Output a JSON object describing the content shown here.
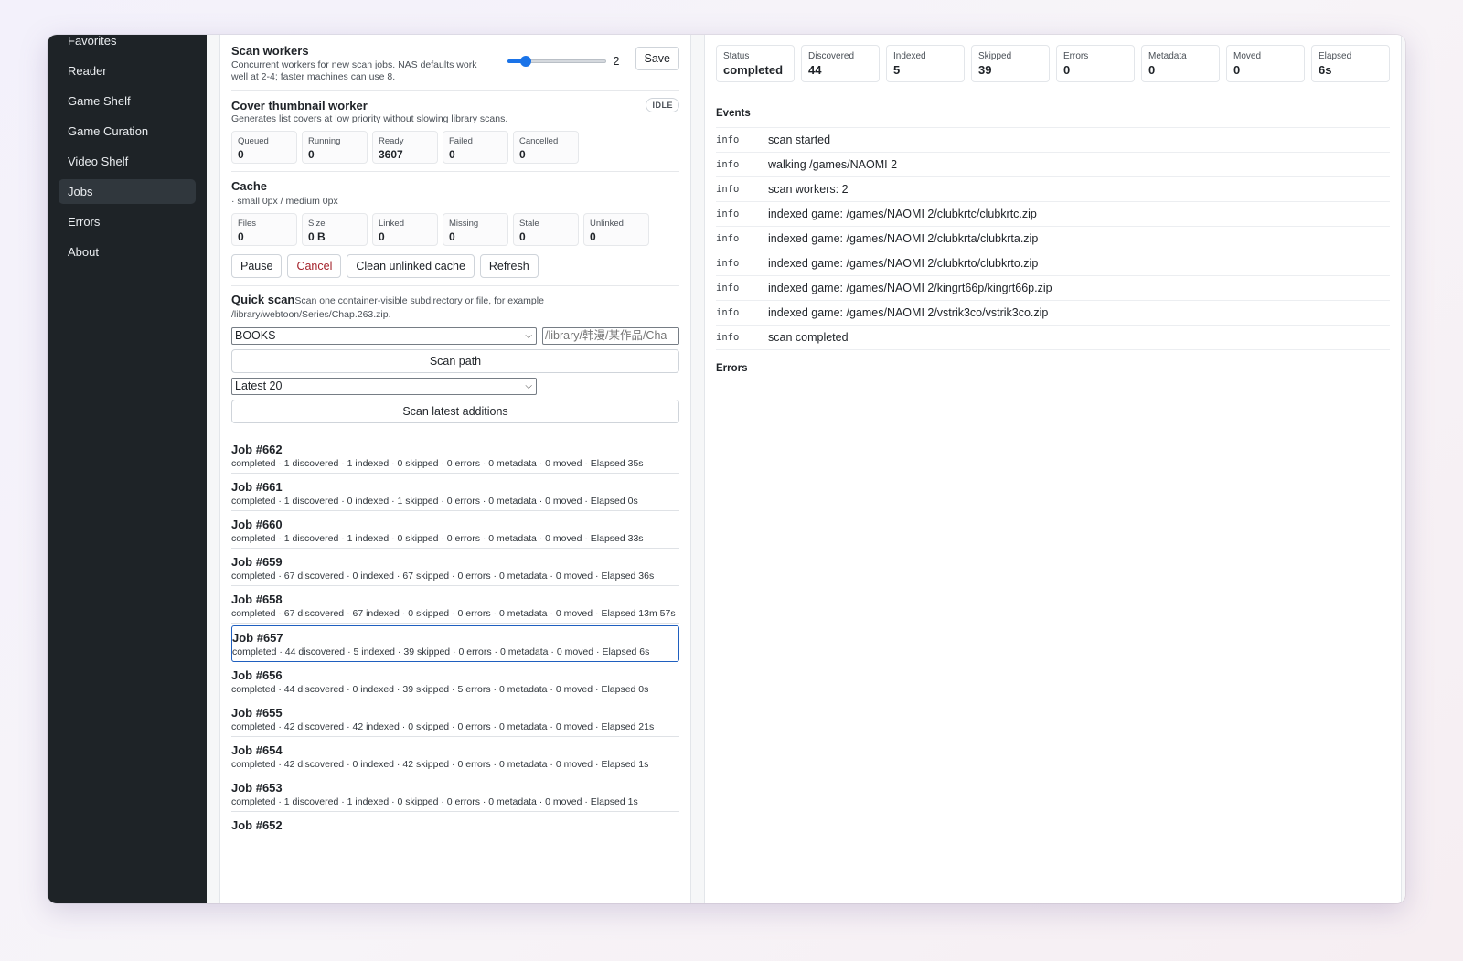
{
  "sidebar": {
    "items": [
      {
        "label": "Favorites",
        "active": false
      },
      {
        "label": "Reader",
        "active": false
      },
      {
        "label": "Game Shelf",
        "active": false
      },
      {
        "label": "Game Curation",
        "active": false
      },
      {
        "label": "Video Shelf",
        "active": false
      },
      {
        "label": "Jobs",
        "active": true
      },
      {
        "label": "Errors",
        "active": false
      },
      {
        "label": "About",
        "active": false
      }
    ]
  },
  "scan_workers": {
    "title": "Scan workers",
    "hint": "Concurrent workers for new scan jobs. NAS defaults work well at 2-4; faster machines can use 8.",
    "value": "2",
    "slider_fraction": 0.125,
    "save_label": "Save"
  },
  "thumb_worker": {
    "title": "Cover thumbnail worker",
    "hint": "Generates list covers at low priority without slowing library scans.",
    "badge": "IDLE",
    "stats": [
      {
        "label": "Queued",
        "value": "0"
      },
      {
        "label": "Running",
        "value": "0"
      },
      {
        "label": "Ready",
        "value": "3607"
      },
      {
        "label": "Failed",
        "value": "0"
      },
      {
        "label": "Cancelled",
        "value": "0"
      }
    ]
  },
  "cache": {
    "title": "Cache",
    "hint": "· small 0px / medium 0px",
    "stats": [
      {
        "label": "Files",
        "value": "0"
      },
      {
        "label": "Size",
        "value": "0 B"
      },
      {
        "label": "Linked",
        "value": "0"
      },
      {
        "label": "Missing",
        "value": "0"
      },
      {
        "label": "Stale",
        "value": "0"
      },
      {
        "label": "Unlinked",
        "value": "0"
      }
    ],
    "buttons": {
      "pause": "Pause",
      "cancel": "Cancel",
      "clean": "Clean unlinked cache",
      "refresh": "Refresh"
    }
  },
  "quick_scan": {
    "title": "Quick scan",
    "hint": "Scan one container-visible subdirectory or file, for example /library/webtoon/Series/Chap.263.zip.",
    "library_select": "BOOKS",
    "path_placeholder": "/library/韩漫/某作品/Cha",
    "scan_path_label": "Scan path",
    "latest_select": "Latest 20",
    "scan_latest_label": "Scan latest additions"
  },
  "jobs": [
    {
      "title": "Job #662",
      "summary": "completed · 1 discovered · 1 indexed · 0 skipped · 0 errors · 0 metadata · 0 moved · Elapsed 35s",
      "selected": false
    },
    {
      "title": "Job #661",
      "summary": "completed · 1 discovered · 0 indexed · 1 skipped · 0 errors · 0 metadata · 0 moved · Elapsed 0s",
      "selected": false
    },
    {
      "title": "Job #660",
      "summary": "completed · 1 discovered · 1 indexed · 0 skipped · 0 errors · 0 metadata · 0 moved · Elapsed 33s",
      "selected": false
    },
    {
      "title": "Job #659",
      "summary": "completed · 67 discovered · 0 indexed · 67 skipped · 0 errors · 0 metadata · 0 moved · Elapsed 36s",
      "selected": false
    },
    {
      "title": "Job #658",
      "summary": "completed · 67 discovered · 67 indexed · 0 skipped · 0 errors · 0 metadata · 0 moved · Elapsed 13m 57s",
      "selected": false
    },
    {
      "title": "Job #657",
      "summary": "completed · 44 discovered · 5 indexed · 39 skipped · 0 errors · 0 metadata · 0 moved · Elapsed 6s",
      "selected": true
    },
    {
      "title": "Job #656",
      "summary": "completed · 44 discovered · 0 indexed · 39 skipped · 5 errors · 0 metadata · 0 moved · Elapsed 0s",
      "selected": false
    },
    {
      "title": "Job #655",
      "summary": "completed · 42 discovered · 42 indexed · 0 skipped · 0 errors · 0 metadata · 0 moved · Elapsed 21s",
      "selected": false
    },
    {
      "title": "Job #654",
      "summary": "completed · 42 discovered · 0 indexed · 42 skipped · 0 errors · 0 metadata · 0 moved · Elapsed 1s",
      "selected": false
    },
    {
      "title": "Job #653",
      "summary": "completed · 1 discovered · 1 indexed · 0 skipped · 0 errors · 0 metadata · 0 moved · Elapsed 1s",
      "selected": false
    },
    {
      "title": "Job #652",
      "summary": "",
      "selected": false
    }
  ],
  "detail": {
    "stats": [
      {
        "label": "Status",
        "value": "completed"
      },
      {
        "label": "Discovered",
        "value": "44"
      },
      {
        "label": "Indexed",
        "value": "5"
      },
      {
        "label": "Skipped",
        "value": "39"
      },
      {
        "label": "Errors",
        "value": "0"
      },
      {
        "label": "Metadata",
        "value": "0"
      },
      {
        "label": "Moved",
        "value": "0"
      },
      {
        "label": "Elapsed",
        "value": "6s"
      }
    ],
    "events_title": "Events",
    "events": [
      {
        "level": "info",
        "message": "scan started"
      },
      {
        "level": "info",
        "message": "walking /games/NAOMI 2"
      },
      {
        "level": "info",
        "message": "scan workers: 2"
      },
      {
        "level": "info",
        "message": "indexed game: /games/NAOMI 2/clubkrtc/clubkrtc.zip"
      },
      {
        "level": "info",
        "message": "indexed game: /games/NAOMI 2/clubkrta/clubkrta.zip"
      },
      {
        "level": "info",
        "message": "indexed game: /games/NAOMI 2/clubkrto/clubkrto.zip"
      },
      {
        "level": "info",
        "message": "indexed game: /games/NAOMI 2/kingrt66p/kingrt66p.zip"
      },
      {
        "level": "info",
        "message": "indexed game: /games/NAOMI 2/vstrik3co/vstrik3co.zip"
      },
      {
        "level": "info",
        "message": "scan completed"
      }
    ],
    "errors_title": "Errors"
  },
  "colors": {
    "sidebar_bg": "#1e2327",
    "accent": "#1a73e8",
    "danger": "#a4232c",
    "selected_border": "#1f5fbf"
  }
}
